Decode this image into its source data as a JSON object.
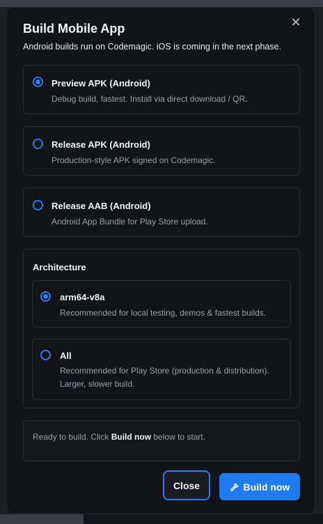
{
  "modal": {
    "title": "Build Mobile App",
    "subtitle": "Android builds run on Codemagic. iOS is coming in the next phase.",
    "close_icon": "x-icon"
  },
  "build_types": [
    {
      "title": "Preview APK (Android)",
      "description": "Debug build, fastest. Install via direct download / QR.",
      "selected": true
    },
    {
      "title": "Release APK (Android)",
      "description": "Production-style APK signed on Codemagic.",
      "selected": false
    },
    {
      "title": "Release AAB (Android)",
      "description": "Android App Bundle for Play Store upload.",
      "selected": false
    }
  ],
  "architecture": {
    "heading": "Architecture",
    "options": [
      {
        "title": "arm64-v8a",
        "description": "Recommended for local testing, demos & fastest builds.",
        "selected": true
      },
      {
        "title": "All",
        "description_line1": "Recommended for Play Store (production & distribution).",
        "description_line2": "Larger, slower build.",
        "selected": false
      }
    ]
  },
  "status": {
    "prefix": "Ready to build. Click ",
    "emphasis": "Build now",
    "suffix": " below to start."
  },
  "actions": {
    "close_label": "Close",
    "build_label": "Build now",
    "build_icon": "hammer-icon"
  },
  "colors": {
    "accent": "#1f7aef",
    "modal_bg": "#121418",
    "border": "#2a2e35"
  }
}
